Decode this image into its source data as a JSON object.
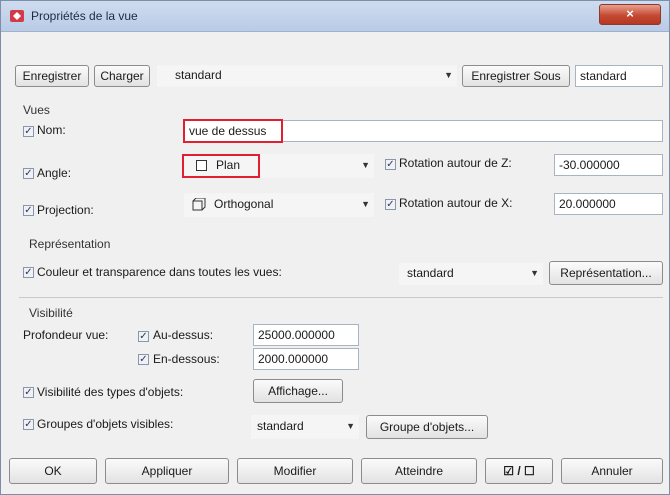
{
  "window": {
    "title": "Propriétés de la vue",
    "close_glyph": "×"
  },
  "top": {
    "save_label": "Enregistrer",
    "load_label": "Charger",
    "preset_value": "standard",
    "save_as_label": "Enregistrer Sous",
    "save_as_value": "standard"
  },
  "vues": {
    "section": "Vues",
    "name_label": "Nom:",
    "name_value": "vue de dessus",
    "angle_label": "Angle:",
    "angle_value": "Plan",
    "rotz_label": "Rotation autour de Z:",
    "rotz_value": "-30.000000",
    "projection_label": "Projection:",
    "projection_value": "Orthogonal",
    "rotx_label": "Rotation autour de X:",
    "rotx_value": "20.000000"
  },
  "representation": {
    "section": "Représentation",
    "color_label": "Couleur et transparence dans toutes les vues:",
    "color_value": "standard",
    "button": "Représentation..."
  },
  "visibilite": {
    "section": "Visibilité",
    "depth_label": "Profondeur vue:",
    "above_label": "Au-dessus:",
    "above_value": "25000.000000",
    "below_label": "En-dessous:",
    "below_value": "2000.000000",
    "types_label": "Visibilité des types d'objets:",
    "types_button": "Affichage...",
    "groups_label": "Groupes d'objets visibles:",
    "groups_value": "standard",
    "groups_button": "Groupe d'objets..."
  },
  "footer": {
    "ok": "OK",
    "apply": "Appliquer",
    "modify": "Modifier",
    "reach": "Atteindre",
    "toggle": "☑ / ☐",
    "cancel": "Annuler"
  },
  "check": "✓",
  "dropdown_arrow": "▼"
}
